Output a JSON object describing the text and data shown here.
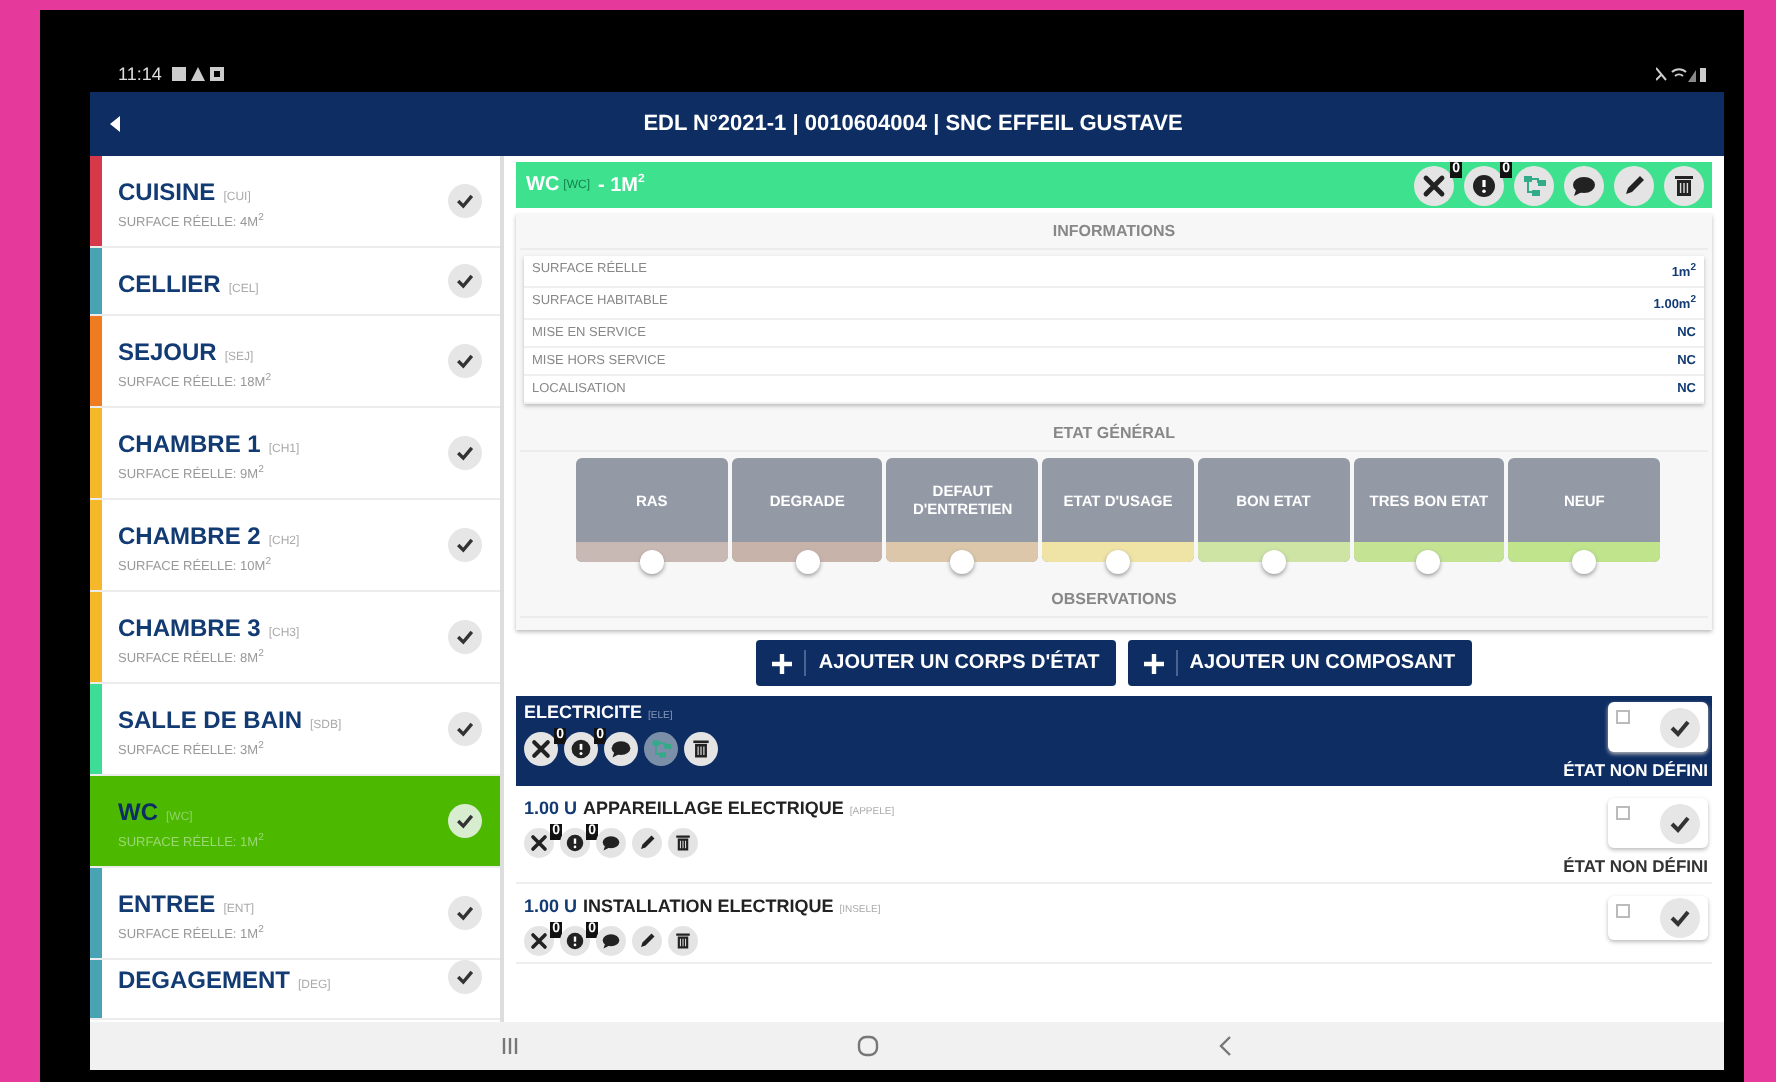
{
  "status_bar": {
    "time": "11:14"
  },
  "header": {
    "title": "EDL N°2021-1 | 0010604004 | SNC EFFEIL GUSTAVE"
  },
  "rooms": [
    {
      "name": "CUISINE",
      "code": "[CUI]",
      "surface": "SURFACE RÉELLE: 4M$^{2}$",
      "color": "#d63a4a",
      "selected": false
    },
    {
      "name": "CELLIER",
      "code": "[CEL]",
      "color": "#4aa3b4",
      "selected": false
    },
    {
      "name": "SEJOUR",
      "code": "[SEJ]",
      "surface": "SURFACE RÉELLE: 18M$^{2}$",
      "color": "#f07c22",
      "selected": false
    },
    {
      "name": "CHAMBRE 1",
      "code": "[CH1]",
      "surface": "SURFACE RÉELLE: 9M$^{2}$",
      "color": "#f5b82a",
      "selected": false
    },
    {
      "name": "CHAMBRE 2",
      "code": "[CH2]",
      "surface": "SURFACE RÉELLE: 10M$^{2}$",
      "color": "#f5b82a",
      "selected": false
    },
    {
      "name": "CHAMBRE 3",
      "code": "[CH3]",
      "surface": "SURFACE RÉELLE: 8M$^{2}$",
      "color": "#f5b82a",
      "selected": false
    },
    {
      "name": "SALLE DE BAIN",
      "code": "[SDB]",
      "surface": "SURFACE RÉELLE: 3M$^{2}$",
      "color": "#3ddc97",
      "selected": false
    },
    {
      "name": "WC",
      "code": "[WC]",
      "surface": "SURFACE RÉELLE: 1M$^{2}$",
      "color": "#4cb800",
      "selected": true
    },
    {
      "name": "ENTREE",
      "code": "[ENT]",
      "surface": "SURFACE RÉELLE: 1M$^{2}$",
      "color": "#4aa3b4",
      "selected": false
    },
    {
      "name": "DEGAGEMENT",
      "code": "[DEG]",
      "color": "#4aa3b4",
      "selected": false
    }
  ],
  "detail": {
    "title": "WC",
    "code": "[WC]",
    "area": "- 1M$^{2}$",
    "badges": [
      "0",
      "0"
    ],
    "info_heading": "INFORMATIONS",
    "info_rows": [
      {
        "label": "SURFACE RÉELLE",
        "value": "1m$^{2}$"
      },
      {
        "label": "SURFACE HABITABLE",
        "value": "1.00m$^{2}$"
      },
      {
        "label": "MISE EN SERVICE",
        "value": "NC"
      },
      {
        "label": "MISE HORS SERVICE",
        "value": "NC"
      },
      {
        "label": "LOCALISATION",
        "value": "NC"
      }
    ],
    "state_heading": "ETAT GÉNÉRAL",
    "states": [
      {
        "label": "RAS",
        "color": "#c9b9b4",
        "selected": false
      },
      {
        "label": "DEGRADE",
        "color": "#c8b3aa",
        "selected": false
      },
      {
        "label": "DEFAUT D'ENTRETIEN",
        "color": "#dcc7aa",
        "selected": false
      },
      {
        "label": "ETAT D'USAGE",
        "color": "#efe3a6",
        "selected": false
      },
      {
        "label": "BON ETAT",
        "color": "#cde4a4",
        "selected": false
      },
      {
        "label": "TRES BON ETAT",
        "color": "#c4e494",
        "selected": false
      },
      {
        "label": "NEUF",
        "color": "#bfe48c",
        "selected": false
      }
    ],
    "observations_heading": "OBSERVATIONS"
  },
  "buttons": [
    {
      "label": "AJOUTER UN CORPS D'ÉTAT"
    },
    {
      "label": "AJOUTER UN COMPOSANT"
    }
  ],
  "sections": [
    {
      "kind": "group",
      "name": "ELECTRICITE",
      "code": "[ELE]",
      "badges": [
        "0",
        "0"
      ],
      "checked": false,
      "state_label": "ÉTAT NON DÉFINI"
    },
    {
      "kind": "component",
      "quantity": "1.00 U",
      "name": "APPAREILLAGE ELECTRIQUE",
      "code": "[APPELE]",
      "badges": [
        "0",
        "0"
      ],
      "checked": false,
      "state_label": "ÉTAT NON DÉFINI"
    },
    {
      "kind": "component",
      "quantity": "1.00 U",
      "name": "INSTALLATION ELECTRIQUE",
      "code": "[INSELE]",
      "badges": [
        "0",
        "0"
      ],
      "checked": false
    }
  ]
}
